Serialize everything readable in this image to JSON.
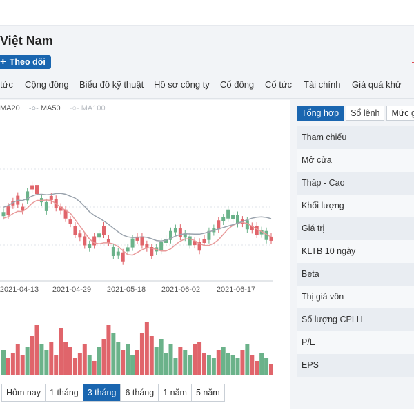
{
  "header": {
    "title": "Việt Nam",
    "follow_label": "Theo dõi"
  },
  "tabs": [
    {
      "label": "tức"
    },
    {
      "label": "Cộng đồng"
    },
    {
      "label": "Biểu đồ kỹ thuật"
    },
    {
      "label": "Hồ sơ công ty"
    },
    {
      "label": "Cổ đông"
    },
    {
      "label": "Cổ tức"
    },
    {
      "label": "Tài chính"
    },
    {
      "label": "Giá quá khứ"
    }
  ],
  "legend": {
    "ma20": "MA20",
    "ma50": "MA50",
    "ma100": "MA100"
  },
  "range_buttons": [
    {
      "label": "Hôm nay"
    },
    {
      "label": "1 tháng"
    },
    {
      "label": "3 tháng",
      "active": true
    },
    {
      "label": "6 tháng"
    },
    {
      "label": "1 năm"
    },
    {
      "label": "5 năm"
    }
  ],
  "side_panel": {
    "tabs": [
      {
        "label": "Tổng hợp",
        "active": true
      },
      {
        "label": "Sổ lệnh"
      },
      {
        "label": "Mức g"
      }
    ],
    "rows": [
      {
        "label": "Tham chiếu"
      },
      {
        "label": "Mở cửa"
      },
      {
        "label": "Thấp - Cao"
      },
      {
        "label": "Khối lượng"
      },
      {
        "label": "Giá trị"
      },
      {
        "label": "KLTB 10 ngày"
      },
      {
        "label": "Beta"
      },
      {
        "label": "Thị giá vốn"
      },
      {
        "label": "Số lượng CPLH"
      },
      {
        "label": "P/E"
      },
      {
        "label": "EPS"
      }
    ]
  },
  "colors": {
    "accent": "#1a66b0",
    "up": "#6bb28a",
    "down": "#e0656b",
    "ma20": "#e89a9a",
    "ma50": "#9aa3ad"
  },
  "chart_data": {
    "type": "candlestick",
    "x_tick_labels": [
      "2021-04-13",
      "2021-04-29",
      "2021-05-18",
      "2021-06-02",
      "2021-06-17"
    ],
    "candles_up": [
      1,
      0,
      0,
      0,
      0,
      1,
      0,
      0,
      1,
      1,
      0,
      0,
      0,
      0,
      0,
      0,
      0,
      0,
      1,
      0,
      1,
      0,
      0,
      1,
      1,
      0,
      1,
      1,
      0,
      0,
      0,
      0,
      1,
      1,
      1,
      1,
      1,
      0,
      1,
      1,
      0,
      0,
      0,
      1,
      1,
      0,
      1,
      1,
      1,
      1,
      0,
      1,
      0,
      0,
      1,
      1,
      0
    ],
    "price_series_min": 0,
    "price_series_max": 1,
    "volume_levels": [
      0.45,
      0.3,
      0.4,
      0.55,
      0.35,
      0.5,
      0.7,
      0.9,
      0.55,
      0.45,
      0.6,
      0.35,
      0.85,
      0.6,
      0.5,
      0.3,
      0.4,
      0.55,
      0.35,
      0.25,
      0.5,
      0.65,
      0.9,
      0.75,
      0.6,
      0.45,
      0.55,
      0.35,
      0.45,
      0.75,
      0.95,
      0.7,
      0.5,
      0.65,
      0.4,
      0.55,
      0.3,
      0.5,
      0.45,
      0.35,
      0.55,
      0.6,
      0.4,
      0.35,
      0.3,
      0.45,
      0.5,
      0.4,
      0.35,
      0.3,
      0.45,
      0.55,
      0.35,
      0.25,
      0.4,
      0.3,
      0.2
    ]
  }
}
